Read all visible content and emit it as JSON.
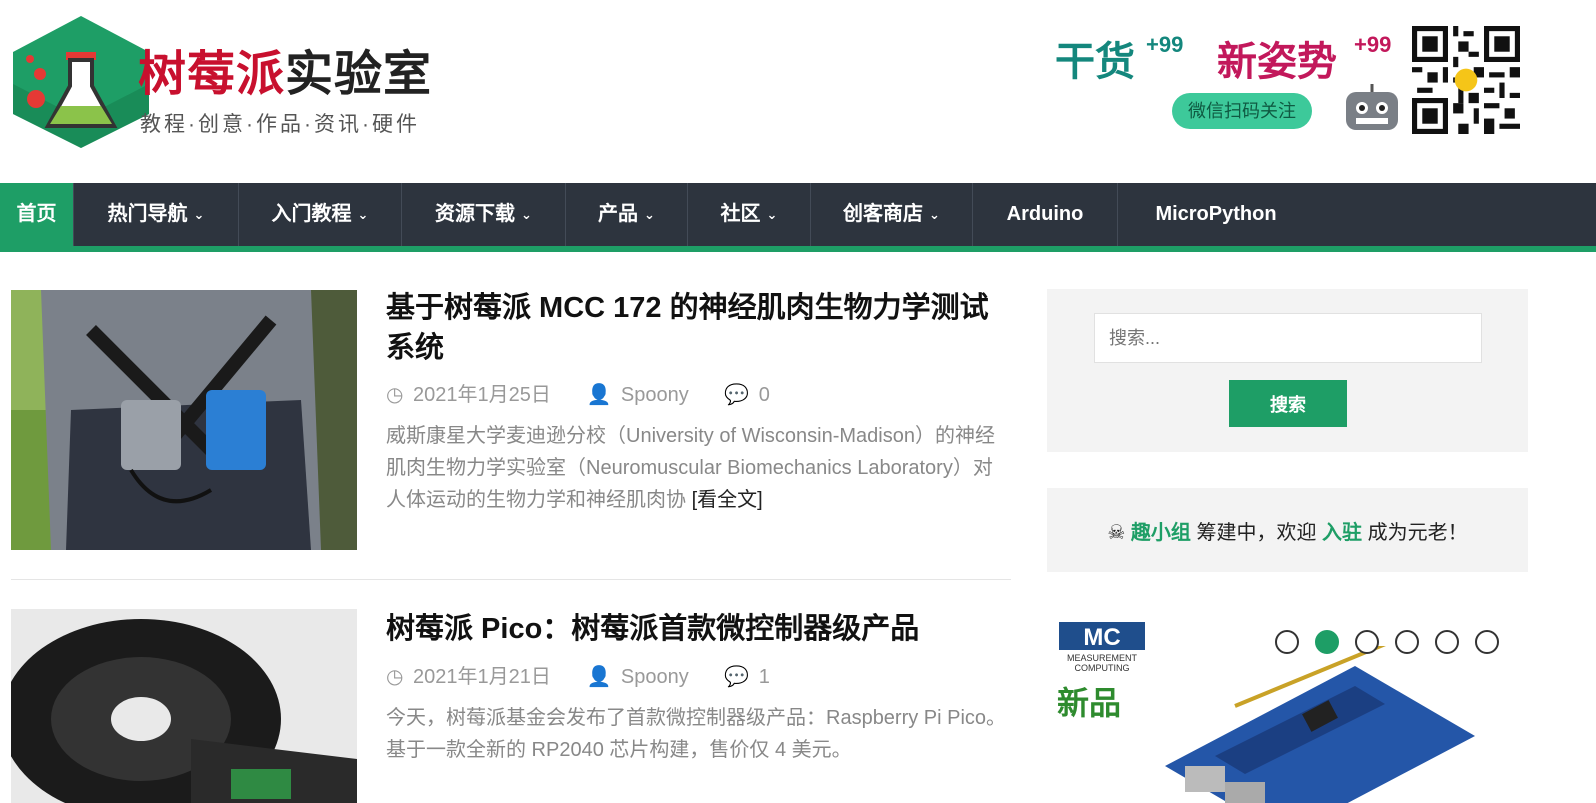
{
  "header": {
    "logo_title_part1": "树莓派",
    "logo_title_part2": "实验室",
    "logo_tagline": "教程·创意·作品·资讯·硬件",
    "promo": {
      "ganhuo": "干货",
      "ganhuo_badge": "+99",
      "xinzi": "新姿势",
      "xinzi_badge": "+99",
      "scan_label": "微信扫码关注"
    }
  },
  "nav": {
    "items": [
      {
        "label": "首页"
      },
      {
        "label": "热门导航"
      },
      {
        "label": "入门教程"
      },
      {
        "label": "资源下载"
      },
      {
        "label": "产品"
      },
      {
        "label": "社区"
      },
      {
        "label": "创客商店"
      },
      {
        "label": "Arduino"
      },
      {
        "label": "MicroPython"
      }
    ]
  },
  "posts": [
    {
      "title": "基于树莓派 MCC 172 的神经肌肉生物力学测试系统",
      "date": "2021年1月25日",
      "author": "Spoony",
      "comments": "0",
      "excerpt": "威斯康星大学麦迪逊分校（University of Wisconsin-Madison）的神经肌肉生物力学实验室（Neuromuscular Biomechanics Laboratory）对人体运动的生物力学和神经肌肉协",
      "more": "[看全文]"
    },
    {
      "title": "树莓派 Pico：树莓派首款微控制器级产品",
      "date": "2021年1月21日",
      "author": "Spoony",
      "comments": "1",
      "excerpt": "今天，树莓派基金会发布了首款微控制器级产品：Raspberry Pi Pico。 基于一款全新的 RP2040 芯片构建，售价仅 4 美元。"
    }
  ],
  "sidebar": {
    "search_placeholder": "搜索...",
    "search_button": "搜索",
    "group": {
      "icon": "☠",
      "name": "趣小组",
      "text1": "筹建中，欢迎",
      "join": "入驻",
      "text2": "成为元老！"
    },
    "ad": {
      "brand_line1": "MEASUREMENT",
      "brand_line2": "COMPUTING",
      "new_label": "新品",
      "slider_active": 2,
      "slider_count": 6
    }
  },
  "colors": {
    "accent": "#1e9e66",
    "nav_bg": "#2d343e",
    "logo_red": "#c8102e"
  }
}
